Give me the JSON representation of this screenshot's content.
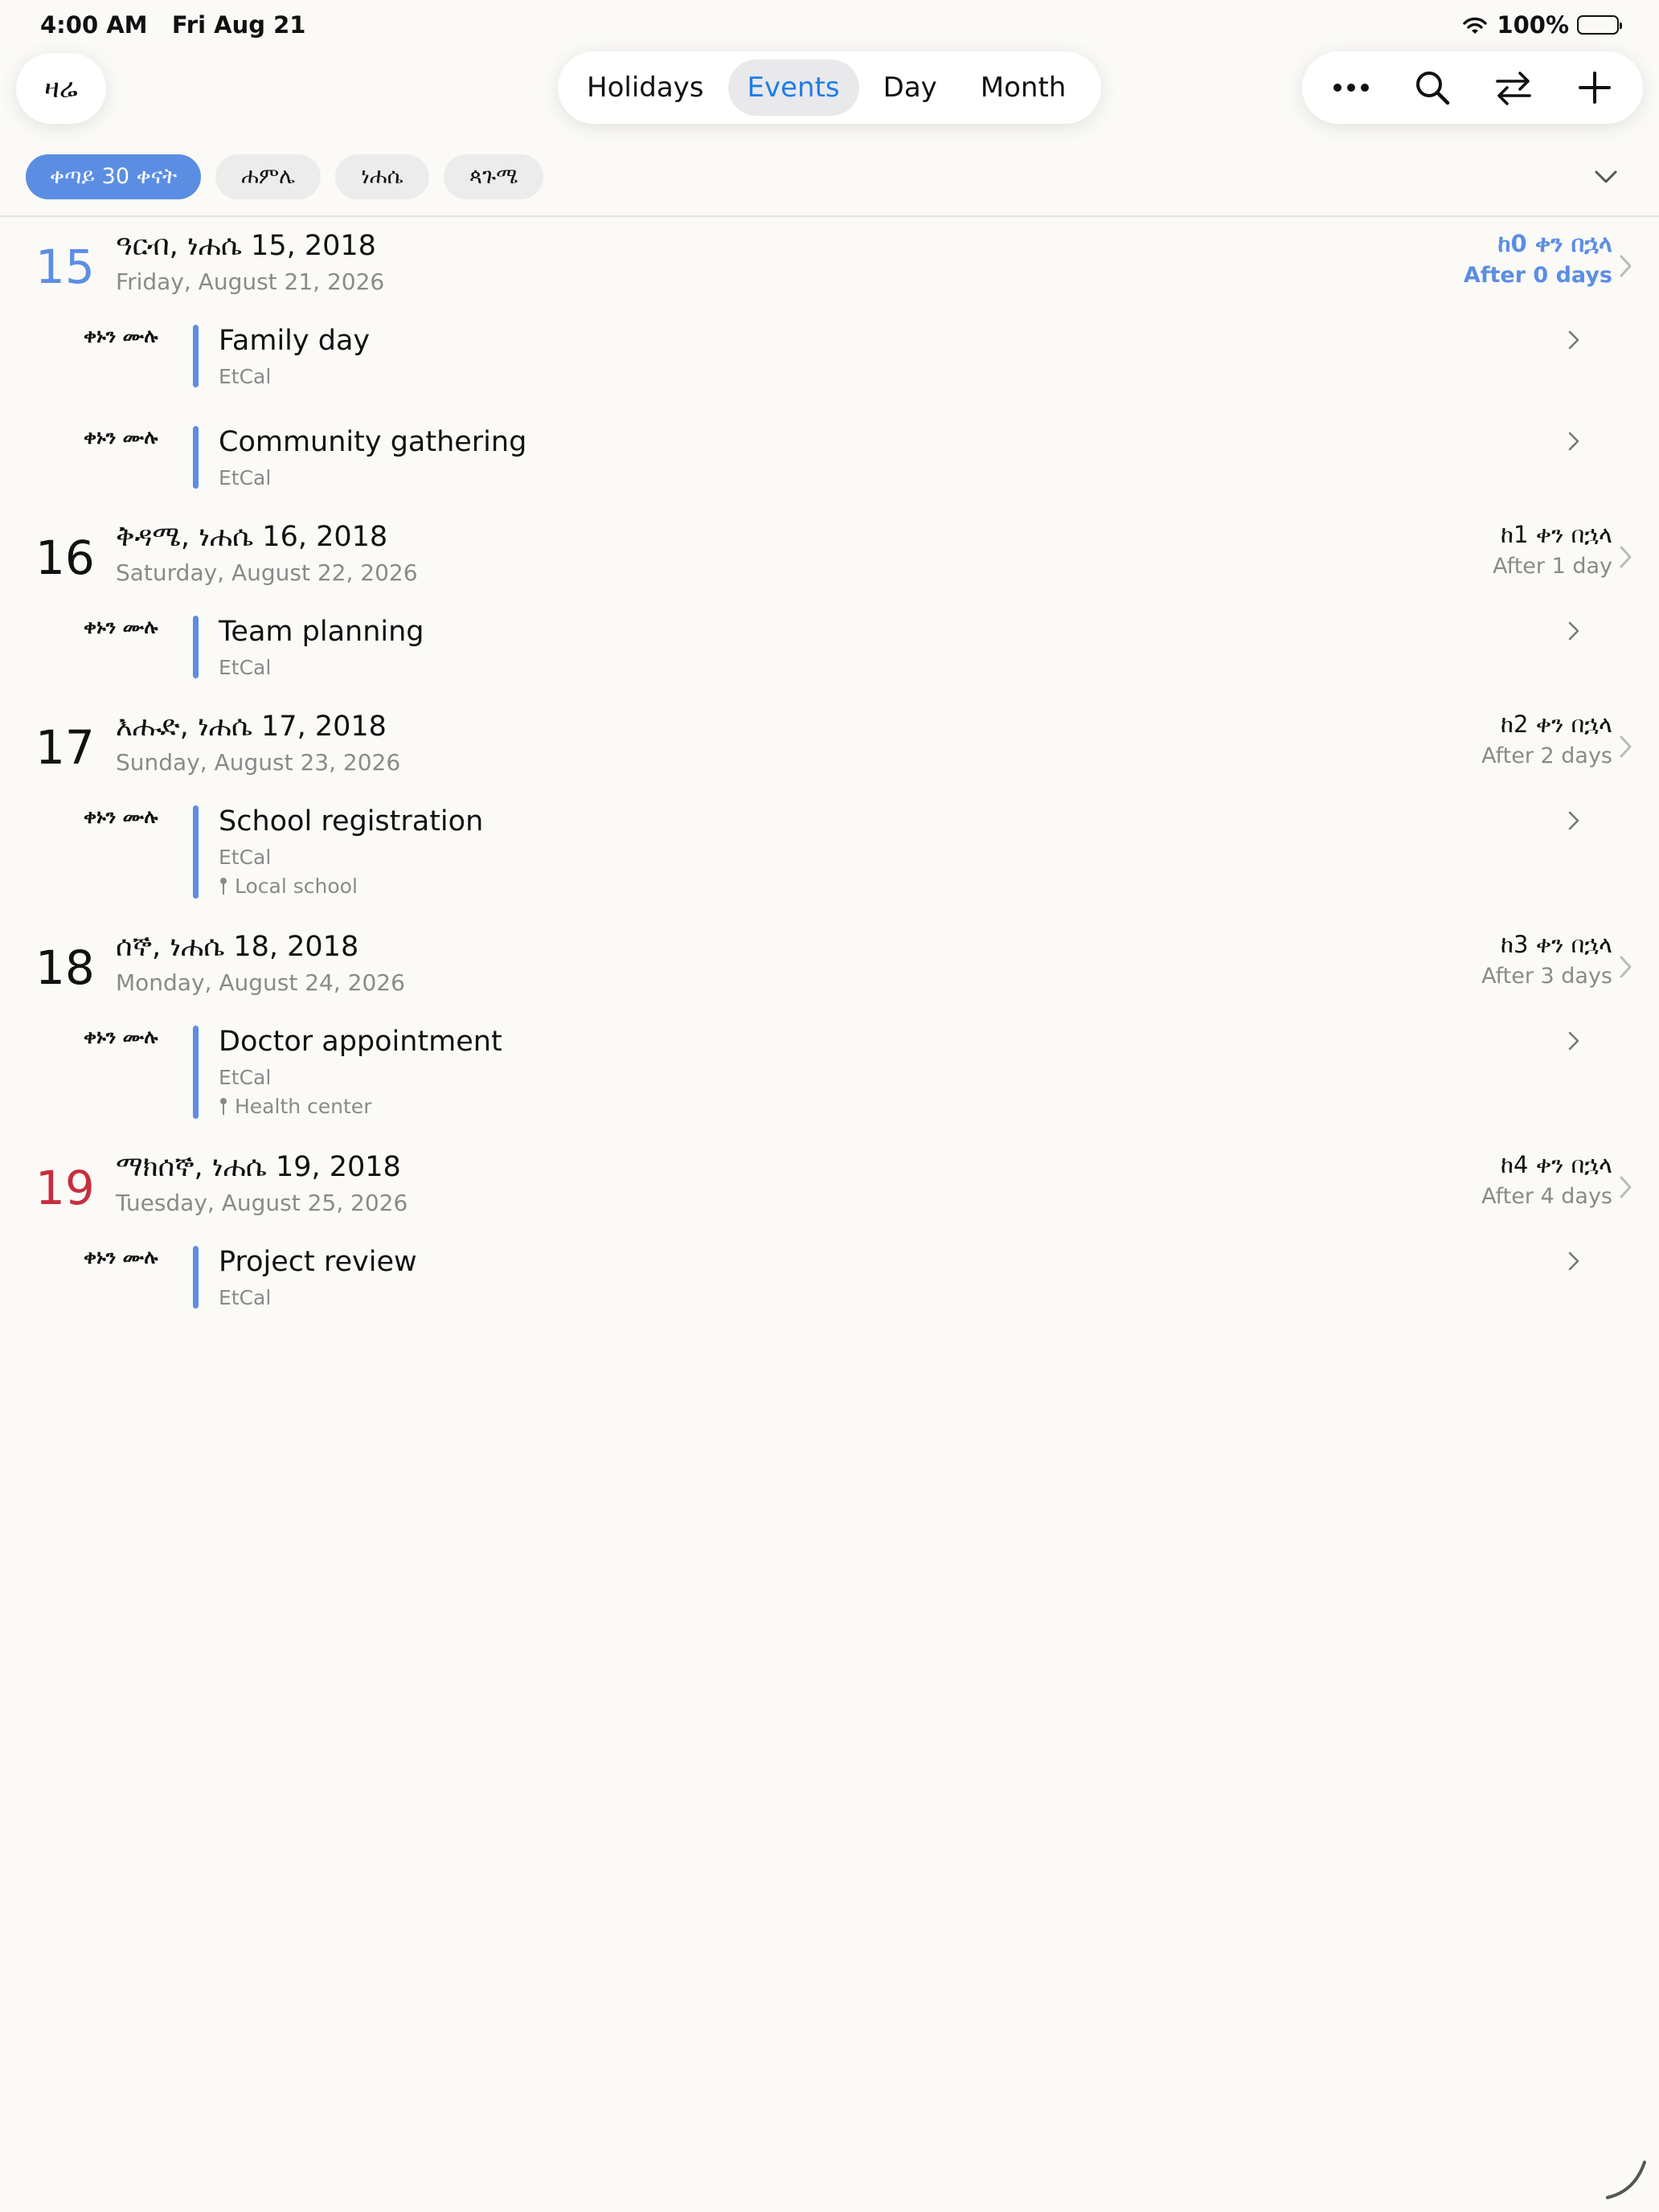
{
  "status": {
    "time": "4:00 AM",
    "date": "Fri Aug 21",
    "battery": "100%"
  },
  "nav": {
    "today": "ዛሬ",
    "tabs": [
      "Holidays",
      "Events",
      "Day",
      "Month"
    ],
    "active_tab": "Events",
    "actions": [
      "more-icon",
      "search-icon",
      "swap-icon",
      "plus-icon"
    ]
  },
  "filters": [
    "ቀጣይ 30 ቀናት",
    "ሐምሌ",
    "ነሐሴ",
    "ጳጉሜ"
  ],
  "accent_color": "#5b8ee3",
  "sunday_color": "#c62f3e",
  "days": [
    {
      "num": "15",
      "title": "ዓርብ, ነሐሴ 15, 2018",
      "subtitle": "Friday, August 21, 2026",
      "eth_rel": "ከ0 ቀን በኋላ",
      "en_rel": "After 0 days",
      "today": true,
      "events": [
        {
          "time": "ቀኑን ሙሉ",
          "title": "Family day",
          "calendar": "EtCal"
        },
        {
          "time": "ቀኑን ሙሉ",
          "title": "Community gathering",
          "calendar": "EtCal"
        }
      ]
    },
    {
      "num": "16",
      "title": "ቅዳሜ, ነሐሴ 16, 2018",
      "subtitle": "Saturday, August 22, 2026",
      "eth_rel": "ከ1 ቀን በኋላ",
      "en_rel": "After 1 day",
      "events": [
        {
          "time": "ቀኑን ሙሉ",
          "title": "Team planning",
          "calendar": "EtCal"
        }
      ]
    },
    {
      "num": "17",
      "title": "እሑድ, ነሐሴ 17, 2018",
      "subtitle": "Sunday, August 23, 2026",
      "eth_rel": "ከ2 ቀን በኋላ",
      "en_rel": "After 2 days",
      "events": [
        {
          "time": "ቀኑን ሙሉ",
          "title": "School registration",
          "calendar": "EtCal",
          "location": "Local school"
        }
      ]
    },
    {
      "num": "18",
      "title": "ሰኞ, ነሐሴ 18, 2018",
      "subtitle": "Monday, August 24, 2026",
      "eth_rel": "ከ3 ቀን በኋላ",
      "en_rel": "After 3 days",
      "events": [
        {
          "time": "ቀኑን ሙሉ",
          "title": "Doctor appointment",
          "calendar": "EtCal",
          "location": "Health center"
        }
      ]
    },
    {
      "num": "19",
      "title": "ማክሰኞ, ነሐሴ 19, 2018",
      "subtitle": "Tuesday, August 25, 2026",
      "eth_rel": "ከ4 ቀን በኋላ",
      "en_rel": "After 4 days",
      "holiday": true,
      "events": [
        {
          "time": "ቀኑን ሙሉ",
          "title": "Project review",
          "calendar": "EtCal"
        }
      ]
    }
  ]
}
